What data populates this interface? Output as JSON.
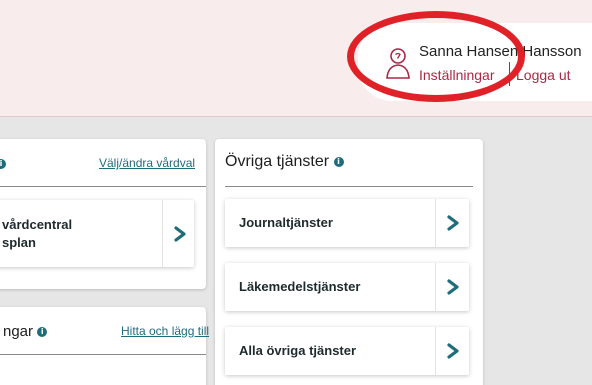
{
  "user": {
    "name": "Sanna Hansen Hansson",
    "settings_label": "Inställningar",
    "logout_label": "Logga ut"
  },
  "left_card": {
    "link": "Välj/ändra vårdval",
    "item_line1": "vårdcentral",
    "item_line2": "splan"
  },
  "left_card2": {
    "title": "ngar",
    "link": "Hitta och lägg till"
  },
  "right_card": {
    "title": "Övriga tjänster",
    "items": [
      {
        "label": "Journaltjänster"
      },
      {
        "label": "Läkemedelstjänster"
      },
      {
        "label": "Alla övriga tjänster"
      }
    ]
  },
  "colors": {
    "accent": "#a72a45",
    "teal": "#1f6d7a",
    "header_bg": "#f9ecec",
    "page_bg": "#e6e6e6",
    "highlight": "#e02228"
  },
  "icons": [
    "user-icon",
    "info-icon",
    "chevron-right-icon"
  ]
}
